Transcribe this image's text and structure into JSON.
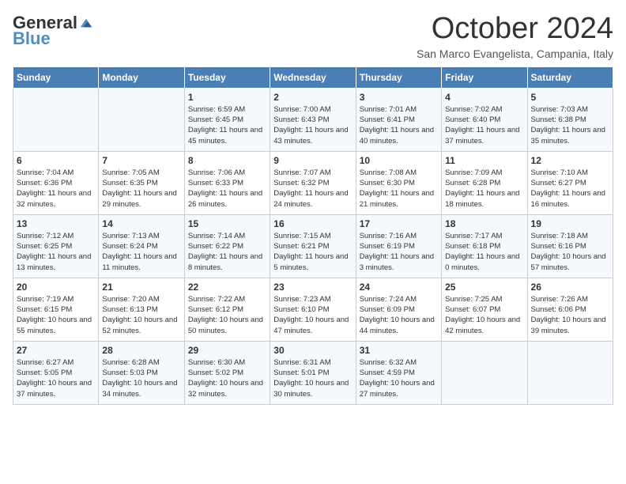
{
  "logo": {
    "general": "General",
    "blue": "Blue"
  },
  "header": {
    "month": "October 2024",
    "location": "San Marco Evangelista, Campania, Italy"
  },
  "days_of_week": [
    "Sunday",
    "Monday",
    "Tuesday",
    "Wednesday",
    "Thursday",
    "Friday",
    "Saturday"
  ],
  "weeks": [
    [
      {
        "day": "",
        "sunrise": "",
        "sunset": "",
        "daylight": ""
      },
      {
        "day": "",
        "sunrise": "",
        "sunset": "",
        "daylight": ""
      },
      {
        "day": "1",
        "sunrise": "Sunrise: 6:59 AM",
        "sunset": "Sunset: 6:45 PM",
        "daylight": "Daylight: 11 hours and 45 minutes."
      },
      {
        "day": "2",
        "sunrise": "Sunrise: 7:00 AM",
        "sunset": "Sunset: 6:43 PM",
        "daylight": "Daylight: 11 hours and 43 minutes."
      },
      {
        "day": "3",
        "sunrise": "Sunrise: 7:01 AM",
        "sunset": "Sunset: 6:41 PM",
        "daylight": "Daylight: 11 hours and 40 minutes."
      },
      {
        "day": "4",
        "sunrise": "Sunrise: 7:02 AM",
        "sunset": "Sunset: 6:40 PM",
        "daylight": "Daylight: 11 hours and 37 minutes."
      },
      {
        "day": "5",
        "sunrise": "Sunrise: 7:03 AM",
        "sunset": "Sunset: 6:38 PM",
        "daylight": "Daylight: 11 hours and 35 minutes."
      }
    ],
    [
      {
        "day": "6",
        "sunrise": "Sunrise: 7:04 AM",
        "sunset": "Sunset: 6:36 PM",
        "daylight": "Daylight: 11 hours and 32 minutes."
      },
      {
        "day": "7",
        "sunrise": "Sunrise: 7:05 AM",
        "sunset": "Sunset: 6:35 PM",
        "daylight": "Daylight: 11 hours and 29 minutes."
      },
      {
        "day": "8",
        "sunrise": "Sunrise: 7:06 AM",
        "sunset": "Sunset: 6:33 PM",
        "daylight": "Daylight: 11 hours and 26 minutes."
      },
      {
        "day": "9",
        "sunrise": "Sunrise: 7:07 AM",
        "sunset": "Sunset: 6:32 PM",
        "daylight": "Daylight: 11 hours and 24 minutes."
      },
      {
        "day": "10",
        "sunrise": "Sunrise: 7:08 AM",
        "sunset": "Sunset: 6:30 PM",
        "daylight": "Daylight: 11 hours and 21 minutes."
      },
      {
        "day": "11",
        "sunrise": "Sunrise: 7:09 AM",
        "sunset": "Sunset: 6:28 PM",
        "daylight": "Daylight: 11 hours and 18 minutes."
      },
      {
        "day": "12",
        "sunrise": "Sunrise: 7:10 AM",
        "sunset": "Sunset: 6:27 PM",
        "daylight": "Daylight: 11 hours and 16 minutes."
      }
    ],
    [
      {
        "day": "13",
        "sunrise": "Sunrise: 7:12 AM",
        "sunset": "Sunset: 6:25 PM",
        "daylight": "Daylight: 11 hours and 13 minutes."
      },
      {
        "day": "14",
        "sunrise": "Sunrise: 7:13 AM",
        "sunset": "Sunset: 6:24 PM",
        "daylight": "Daylight: 11 hours and 11 minutes."
      },
      {
        "day": "15",
        "sunrise": "Sunrise: 7:14 AM",
        "sunset": "Sunset: 6:22 PM",
        "daylight": "Daylight: 11 hours and 8 minutes."
      },
      {
        "day": "16",
        "sunrise": "Sunrise: 7:15 AM",
        "sunset": "Sunset: 6:21 PM",
        "daylight": "Daylight: 11 hours and 5 minutes."
      },
      {
        "day": "17",
        "sunrise": "Sunrise: 7:16 AM",
        "sunset": "Sunset: 6:19 PM",
        "daylight": "Daylight: 11 hours and 3 minutes."
      },
      {
        "day": "18",
        "sunrise": "Sunrise: 7:17 AM",
        "sunset": "Sunset: 6:18 PM",
        "daylight": "Daylight: 11 hours and 0 minutes."
      },
      {
        "day": "19",
        "sunrise": "Sunrise: 7:18 AM",
        "sunset": "Sunset: 6:16 PM",
        "daylight": "Daylight: 10 hours and 57 minutes."
      }
    ],
    [
      {
        "day": "20",
        "sunrise": "Sunrise: 7:19 AM",
        "sunset": "Sunset: 6:15 PM",
        "daylight": "Daylight: 10 hours and 55 minutes."
      },
      {
        "day": "21",
        "sunrise": "Sunrise: 7:20 AM",
        "sunset": "Sunset: 6:13 PM",
        "daylight": "Daylight: 10 hours and 52 minutes."
      },
      {
        "day": "22",
        "sunrise": "Sunrise: 7:22 AM",
        "sunset": "Sunset: 6:12 PM",
        "daylight": "Daylight: 10 hours and 50 minutes."
      },
      {
        "day": "23",
        "sunrise": "Sunrise: 7:23 AM",
        "sunset": "Sunset: 6:10 PM",
        "daylight": "Daylight: 10 hours and 47 minutes."
      },
      {
        "day": "24",
        "sunrise": "Sunrise: 7:24 AM",
        "sunset": "Sunset: 6:09 PM",
        "daylight": "Daylight: 10 hours and 44 minutes."
      },
      {
        "day": "25",
        "sunrise": "Sunrise: 7:25 AM",
        "sunset": "Sunset: 6:07 PM",
        "daylight": "Daylight: 10 hours and 42 minutes."
      },
      {
        "day": "26",
        "sunrise": "Sunrise: 7:26 AM",
        "sunset": "Sunset: 6:06 PM",
        "daylight": "Daylight: 10 hours and 39 minutes."
      }
    ],
    [
      {
        "day": "27",
        "sunrise": "Sunrise: 6:27 AM",
        "sunset": "Sunset: 5:05 PM",
        "daylight": "Daylight: 10 hours and 37 minutes."
      },
      {
        "day": "28",
        "sunrise": "Sunrise: 6:28 AM",
        "sunset": "Sunset: 5:03 PM",
        "daylight": "Daylight: 10 hours and 34 minutes."
      },
      {
        "day": "29",
        "sunrise": "Sunrise: 6:30 AM",
        "sunset": "Sunset: 5:02 PM",
        "daylight": "Daylight: 10 hours and 32 minutes."
      },
      {
        "day": "30",
        "sunrise": "Sunrise: 6:31 AM",
        "sunset": "Sunset: 5:01 PM",
        "daylight": "Daylight: 10 hours and 30 minutes."
      },
      {
        "day": "31",
        "sunrise": "Sunrise: 6:32 AM",
        "sunset": "Sunset: 4:59 PM",
        "daylight": "Daylight: 10 hours and 27 minutes."
      },
      {
        "day": "",
        "sunrise": "",
        "sunset": "",
        "daylight": ""
      },
      {
        "day": "",
        "sunrise": "",
        "sunset": "",
        "daylight": ""
      }
    ]
  ]
}
